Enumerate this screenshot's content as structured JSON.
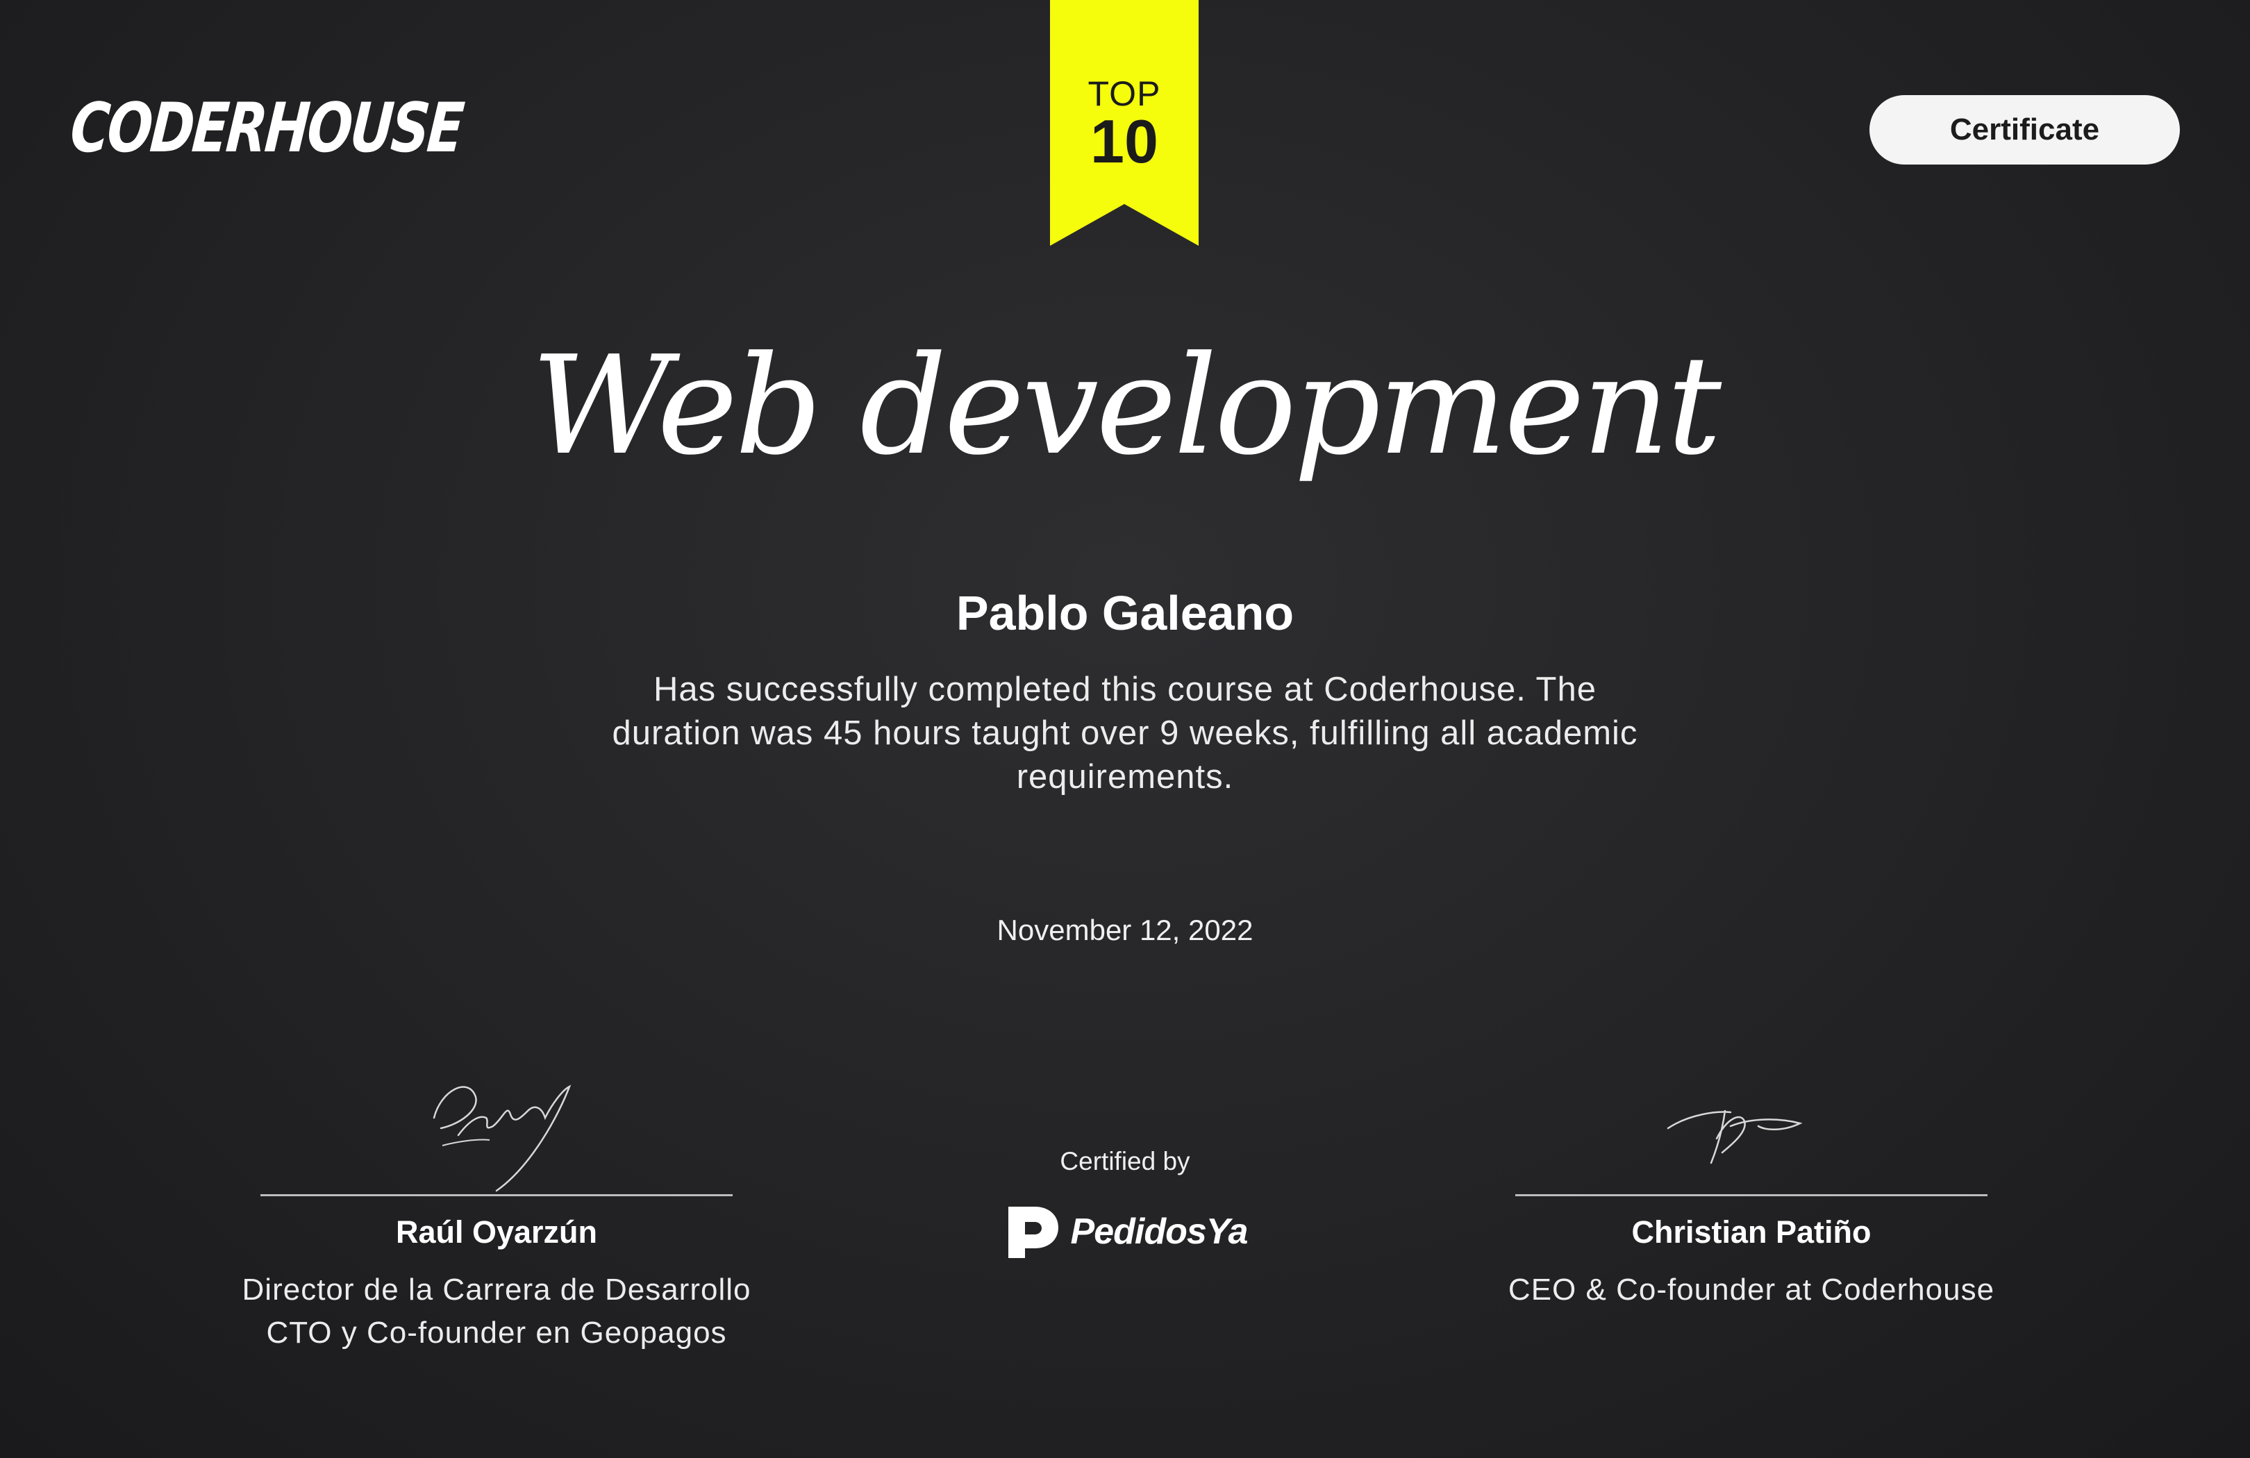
{
  "brand": {
    "logo_text": "CODERHOUSE"
  },
  "badge": {
    "top": "TOP",
    "number": "10",
    "color": "#f5fc0c"
  },
  "header": {
    "certificate_label": "Certificate"
  },
  "course": {
    "title": "Web development"
  },
  "student": {
    "name": "Pablo Galeano"
  },
  "completion": {
    "description": "Has successfully completed this course at Coderhouse. The duration was 45 hours taught over 9 weeks, fulfilling all academic requirements.",
    "date": "November 12, 2022"
  },
  "signers": [
    {
      "name": "Raúl Oyarzún",
      "role_line1": "Director de la Carrera de Desarrollo",
      "role_line2": "CTO y Co-founder en Geopagos"
    },
    {
      "name": "Christian Patiño",
      "role_line1": "CEO & Co-founder at Coderhouse"
    }
  ],
  "certified": {
    "label": "Certified by",
    "partner_name": "PedidosYa"
  },
  "colors": {
    "background": "#232325",
    "text": "#ffffff",
    "accent": "#f5fc0c"
  }
}
